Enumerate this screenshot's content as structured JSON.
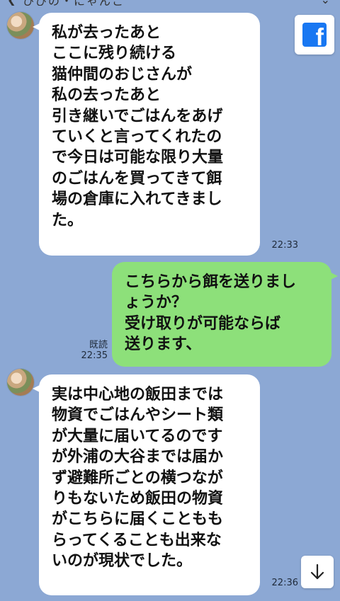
{
  "header": {
    "back_icon": "chevron-left-icon",
    "title": "ひびの・にゃんこ",
    "menu_icon": "chevron-down-icon"
  },
  "buttons": {
    "facebook_icon": "facebook-icon",
    "facebook_letter": "f",
    "scroll_down_icon": "arrow-down-icon",
    "scroll_down_glyph": "↓"
  },
  "colors": {
    "background": "#8ca8d4",
    "received_bubble": "#ffffff",
    "sent_bubble": "#8de07a",
    "facebook_blue": "#1877f2"
  },
  "messages": [
    {
      "direction": "received",
      "text": "私が去ったあと\nここに残り続ける\n猫仲間のおじさんが\n私の去ったあと\n引き継いでごはんをあげ\nていくと言ってくれたの\nで今日は可能な限り大量\nのごはんを買ってきて餌\n場の倉庫に入れてきまし\nた。",
      "time": "22:33"
    },
    {
      "direction": "sent",
      "text": "こちらから餌を送りまし\nょうか？\n受け取りが可能ならば\n送ります、",
      "read": "既読",
      "time": "22:35"
    },
    {
      "direction": "received",
      "text": "実は中心地の飯田までは\n物資でごはんやシート類\nが大量に届いてるのです\nが外浦の大谷までは届か\nず避難所ごとの横つなが\nりもないため飯田の物資\nがこちらに届くこともも\nらってくることも出来な\nいのが現状でした。",
      "time": "22:36"
    }
  ]
}
